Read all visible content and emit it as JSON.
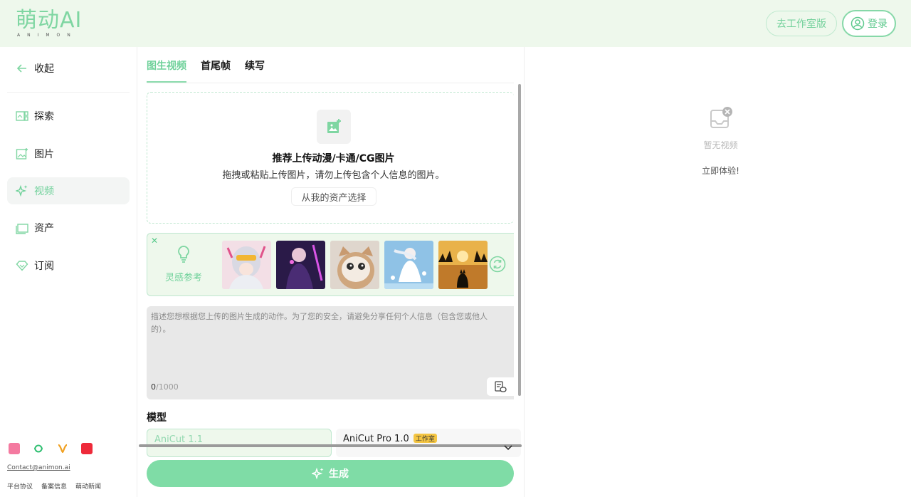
{
  "header": {
    "logo_text": "萌动AI",
    "logo_sub": "ANIMON",
    "studio_button": "去工作室版",
    "login_button": "登录"
  },
  "sidebar": {
    "collapse": "收起",
    "items": [
      {
        "label": "探索",
        "icon": "explore-icon"
      },
      {
        "label": "图片",
        "icon": "image-icon"
      },
      {
        "label": "视频",
        "icon": "sparkle-icon"
      },
      {
        "label": "资产",
        "icon": "folder-icon"
      },
      {
        "label": "订阅",
        "icon": "diamond-icon"
      }
    ],
    "active_index": 2,
    "social": [
      "bilibili",
      "wechat-video",
      "weibo",
      "xiaohongshu"
    ],
    "contact": "Contact@animon.ai",
    "footer_links": [
      "平台协议",
      "备案信息",
      "萌动新闻"
    ]
  },
  "tabs": [
    "图生视频",
    "首尾帧",
    "续写"
  ],
  "upload": {
    "title": "推荐上传动漫/卡通/CG图片",
    "desc": "拖拽或粘贴上传图片，请勿上传包含个人信息的图片。",
    "asset_button": "从我的资产选择"
  },
  "inspiration": {
    "label": "灵感参考",
    "thumbnails": [
      "anime-girl-headphones",
      "dark-fantasy-girl",
      "kitten-photo",
      "white-dress-girl",
      "cat-sunset"
    ]
  },
  "prompt": {
    "placeholder": "描述您想根据您上传的图片生成的动作。为了您的安全，请避免分享任何个人信息（包含您或他人的）。",
    "count": "0",
    "max": "/1000"
  },
  "model": {
    "title": "模型",
    "options": [
      {
        "name": "AniCut 1.1",
        "badge": ""
      },
      {
        "name": "AniCut Pro 1.0",
        "badge": "工作室"
      }
    ]
  },
  "generate_button": "生成",
  "preview": {
    "empty_text": "暂无视频",
    "try_link": "立即体验!"
  },
  "colors": {
    "accent": "#6fd19a",
    "header_bg": "#eef8ec",
    "generate_bg": "#7fdca6"
  }
}
